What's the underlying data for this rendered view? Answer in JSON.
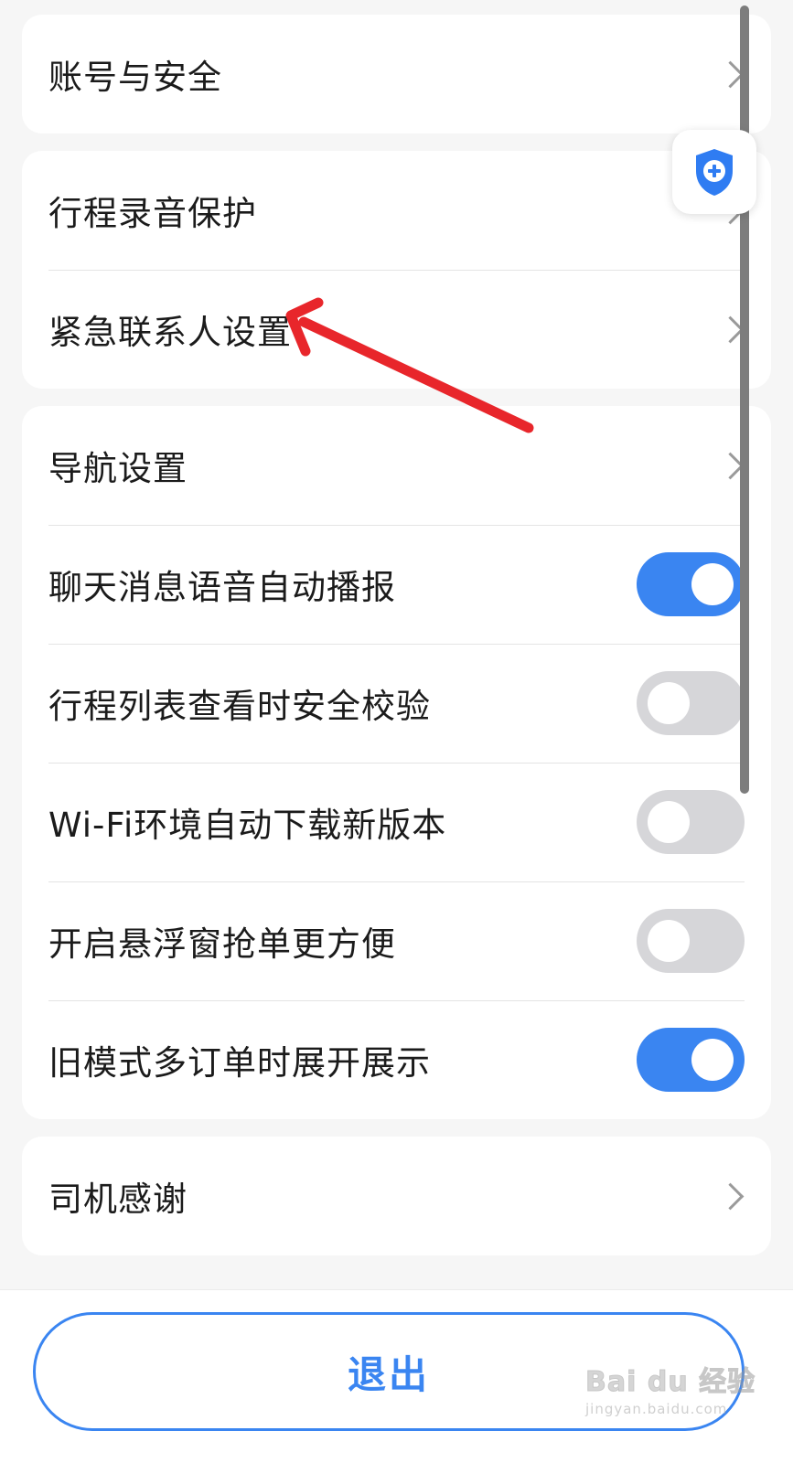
{
  "settings_groups": [
    {
      "rows": [
        {
          "label": "账号与安全",
          "control": "chevron"
        }
      ]
    },
    {
      "rows": [
        {
          "label": "行程录音保护",
          "control": "chevron"
        },
        {
          "label": "紧急联系人设置",
          "control": "chevron"
        }
      ]
    },
    {
      "rows": [
        {
          "label": "导航设置",
          "control": "chevron"
        },
        {
          "label": "聊天消息语音自动播报",
          "control": "toggle",
          "on": true
        },
        {
          "label": "行程列表查看时安全校验",
          "control": "toggle",
          "on": false
        },
        {
          "label": "Wi-Fi环境自动下载新版本",
          "control": "toggle",
          "on": false
        },
        {
          "label": "开启悬浮窗抢单更方便",
          "control": "toggle",
          "on": false
        },
        {
          "label": "旧模式多订单时展开展示",
          "control": "toggle",
          "on": true
        }
      ]
    },
    {
      "rows": [
        {
          "label": "司机感谢",
          "control": "chevron"
        }
      ]
    }
  ],
  "logout": {
    "label": "退出"
  },
  "watermark": {
    "main": "Bai du 经验",
    "sub": "jingyan.baidu.com"
  },
  "icons": {
    "row_action": "chevron-right-icon",
    "floating": "shield-plus-icon"
  },
  "colors": {
    "accent": "#3a85f1",
    "toggle_off": "#d6d6d9",
    "annotation_arrow": "#e8262b"
  }
}
